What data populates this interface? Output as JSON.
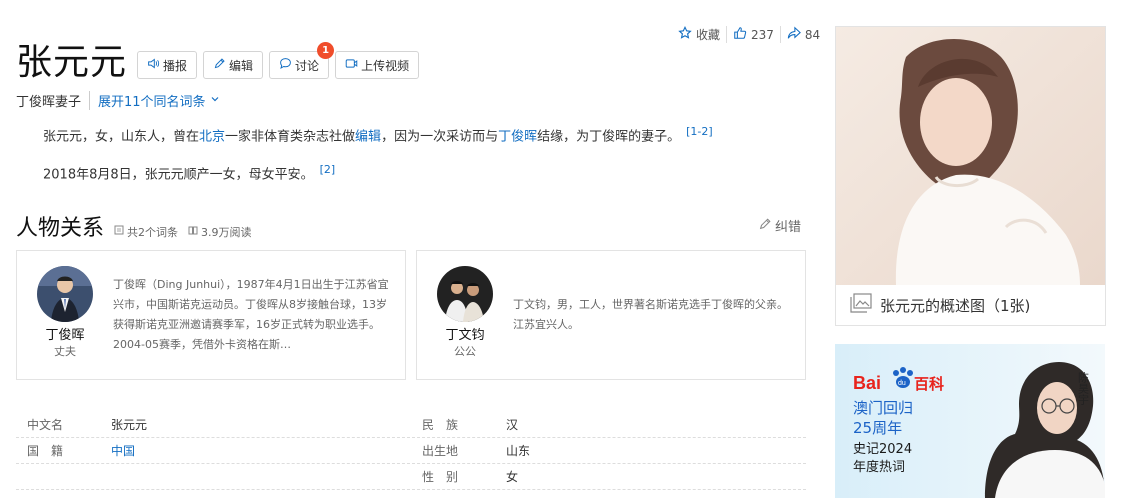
{
  "stats": {
    "collect": "收藏",
    "likes": "237",
    "shares": "84"
  },
  "title": "张元元",
  "buttons": {
    "broadcast": "播报",
    "edit": "编辑",
    "discuss": "讨论",
    "discuss_badge": "1",
    "upload_video": "上传视频"
  },
  "subtitle": "丁俊晖妻子",
  "same_name": "展开11个同名词条",
  "summary": {
    "p1_a": "张元元，女，山东人，曾在",
    "p1_link1": "北京",
    "p1_b": "一家非体育类杂志社做",
    "p1_link2": "编辑",
    "p1_c": "，因为一次采访而与",
    "p1_link3": "丁俊晖",
    "p1_d": "结缘，为丁俊晖的妻子。",
    "p1_ref": "[1-2]",
    "p2": "2018年8月8日，张元元顺产一女，母女平安。",
    "p2_ref": "[2]"
  },
  "relations": {
    "title": "人物关系",
    "count": "共2个词条",
    "reads": "3.9万阅读",
    "correct": "纠错",
    "cards": [
      {
        "name": "丁俊晖",
        "role": "丈夫",
        "desc": "丁俊晖（Ding Junhui），1987年4月1日出生于江苏省宜兴市，中国斯诺克运动员。丁俊晖从8岁接触台球，13岁获得斯诺克亚洲邀请赛季军，16岁正式转为职业选手。2004-05赛季，凭借外卡资格在斯…"
      },
      {
        "name": "丁文钧",
        "role": "公公",
        "desc": "丁文钧，男，工人，世界著名斯诺克选手丁俊晖的父亲。江苏宜兴人。"
      }
    ]
  },
  "info": [
    {
      "l1": "中文名",
      "v1": "张元元",
      "v1_link": false,
      "l2": "民　族",
      "v2": "汉"
    },
    {
      "l1": "国　籍",
      "v1": "中国",
      "v1_link": true,
      "l2": "出生地",
      "v2": "山东"
    },
    {
      "l1": "",
      "v1": "",
      "v1_link": false,
      "l2": "性　别",
      "v2": "女"
    }
  ],
  "summary_image": {
    "caption": "张元元的概述图（1张)"
  },
  "ad": {
    "brand": "百科",
    "line1": "澳门回归",
    "line2": "25周年",
    "line3": "史记2024",
    "line4": "年度热词",
    "person": "陈昊宇"
  },
  "colors": {
    "link": "#136ec2",
    "badge": "#f04d2b",
    "ad_brand": "#e8241d",
    "ad_blue": "#1c63c7"
  }
}
